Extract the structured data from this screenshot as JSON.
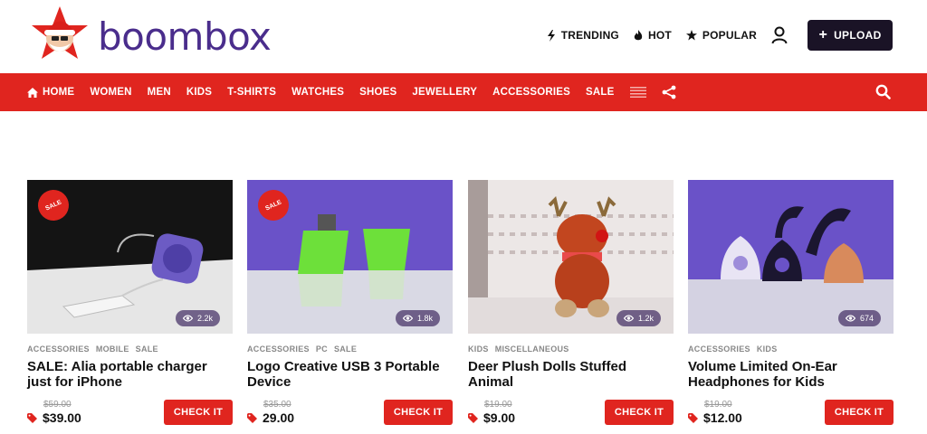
{
  "brand": {
    "name": "boombox"
  },
  "topnav": {
    "trending": "TRENDING",
    "hot": "HOT",
    "popular": "POPULAR",
    "upload": "UPLOAD"
  },
  "mainnav": {
    "items": [
      "HOME",
      "WOMEN",
      "MEN",
      "KIDS",
      "T-SHIRTS",
      "WATCHES",
      "SHOES",
      "JEWELLERY",
      "ACCESSORIES",
      "SALE"
    ]
  },
  "products": [
    {
      "sale_badge": "SALE",
      "views": "2.2k",
      "categories": [
        "ACCESSORIES",
        "MOBILE",
        "SALE"
      ],
      "title": "SALE: Alia portable charger just for iPhone",
      "old_price": "$59.00",
      "price": "$39.00",
      "button": "CHECK IT"
    },
    {
      "sale_badge": "SALE",
      "views": "1.8k",
      "categories": [
        "ACCESSORIES",
        "PC",
        "SALE"
      ],
      "title": "Logo Creative USB 3 Portable Device",
      "old_price": "$35.00",
      "price": "29.00",
      "button": "CHECK IT"
    },
    {
      "views": "1.2k",
      "categories": [
        "KIDS",
        "MISCELLANEOUS"
      ],
      "title": "Deer Plush Dolls Stuffed Animal",
      "old_price": "$19.00",
      "price": "$9.00",
      "button": "CHECK IT"
    },
    {
      "views": "674",
      "categories": [
        "ACCESSORIES",
        "KIDS"
      ],
      "title": "Volume Limited On-Ear Headphones for Kids",
      "old_price": "$19.00",
      "price": "$12.00",
      "button": "CHECK IT"
    }
  ],
  "colors": {
    "accent": "#e0251f",
    "brand_purple": "#4a2d8c",
    "dark_button": "#1a1326"
  }
}
